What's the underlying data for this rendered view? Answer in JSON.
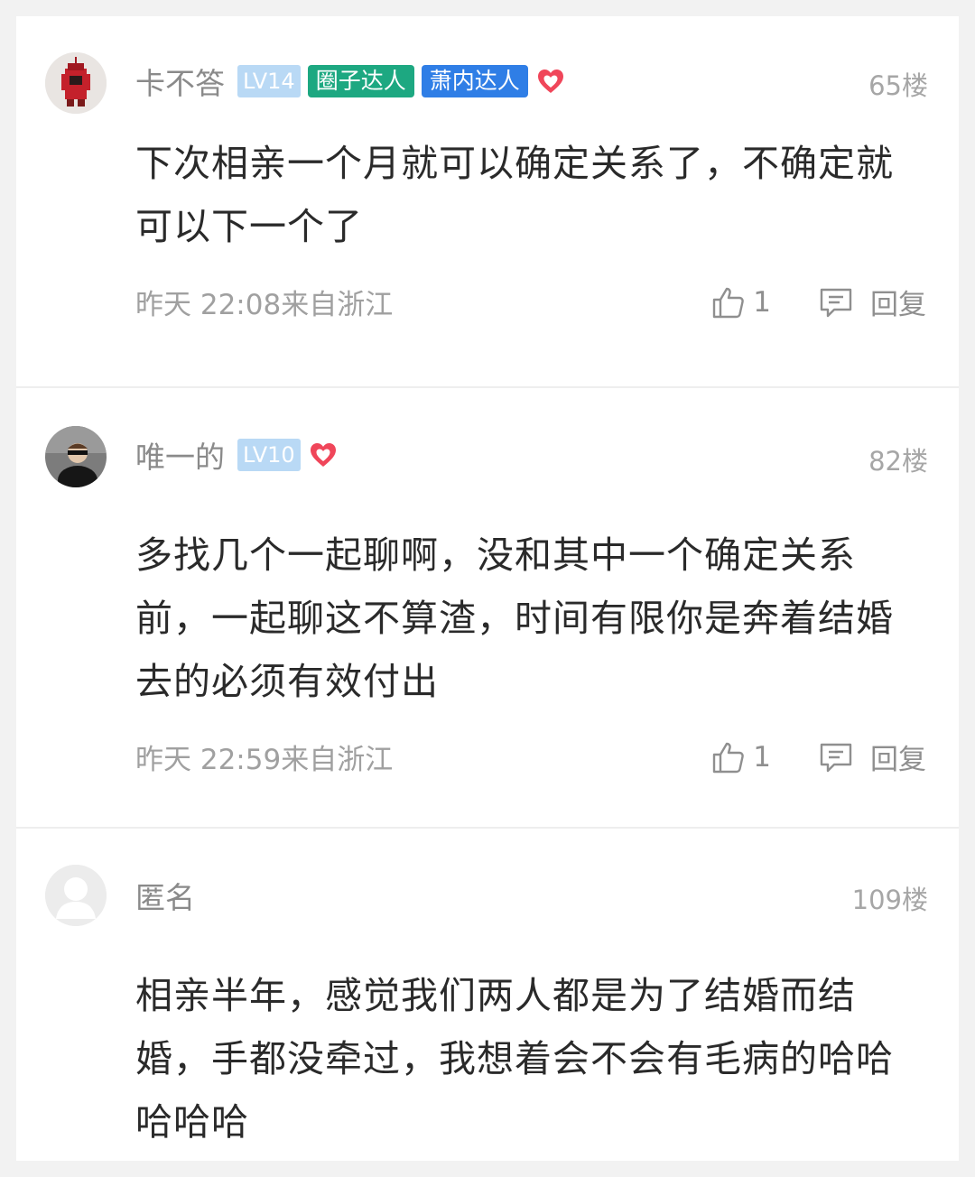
{
  "comments": [
    {
      "username": "卡不答",
      "level": "LV14",
      "badges": [
        "圈子达人",
        "萧内达人"
      ],
      "floor": "65楼",
      "content": "下次相亲一个月就可以确定关系了，不确定就可以下一个了",
      "meta": "昨天 22:08来自浙江",
      "likes": "1",
      "reply_label": "回复"
    },
    {
      "username": "唯一的",
      "level": "LV10",
      "floor": "82楼",
      "content": "多找几个一起聊啊，没和其中一个确定关系前，一起聊这不算渣，时间有限你是奔着结婚去的必须有效付出",
      "meta": "昨天 22:59来自浙江",
      "likes": "1",
      "reply_label": "回复"
    },
    {
      "username": "匿名",
      "floor": "109楼",
      "content": "相亲半年，感觉我们两人都是为了结婚而结婚，手都没牵过，我想着会不会有毛病的哈哈哈哈哈"
    }
  ],
  "colors": {
    "badge_green": "#1da881",
    "badge_blue": "#2f7ee6",
    "level_badge": "#b9d9f5",
    "heart": "#f0465a"
  },
  "icons": [
    "heart-icon",
    "thumbs-up-icon",
    "comment-bubble-icon",
    "default-avatar-icon"
  ]
}
